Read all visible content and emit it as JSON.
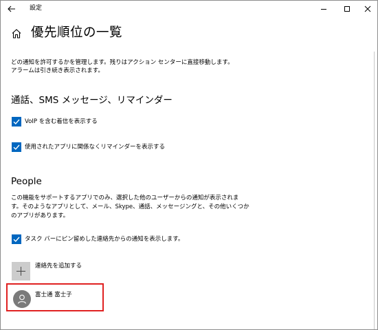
{
  "window": {
    "title": "設定"
  },
  "header": {
    "page_title": "優先順位の一覧"
  },
  "intro": {
    "line1": "どの通知を許可するかを管理します。残りはアクション センターに直接移動します。",
    "line2": "アラームは引き続き表示されます。"
  },
  "calls_section": {
    "title": "通話、SMS メッセージ、リマインダー",
    "checkboxes": [
      {
        "label": "VoIP を含む着信を表示する",
        "checked": true
      },
      {
        "label": "使用されたアプリに関係なくリマインダーを表示する",
        "checked": true
      }
    ]
  },
  "people_section": {
    "title": "People",
    "desc_line1": "この機能をサポートするアプリでのみ、選択した他のユーザーからの通知が表示されま",
    "desc_line2": "す。そのようなアプリとして、メール、Skype、通話、メッセージングと、その他いくつか",
    "desc_line3": "のアプリがあります。",
    "taskbar_checkbox": {
      "label": "タスク バーにピン留めした連絡先からの通知を表示します。",
      "checked": true
    },
    "add_contact_label": "連絡先を追加する",
    "contacts": [
      {
        "name": "富士通 富士子"
      }
    ]
  },
  "colors": {
    "accent": "#0067c0",
    "highlight_border": "#e02020",
    "add_button_bg": "#cccccc",
    "avatar_bg": "#7a7a7a"
  }
}
